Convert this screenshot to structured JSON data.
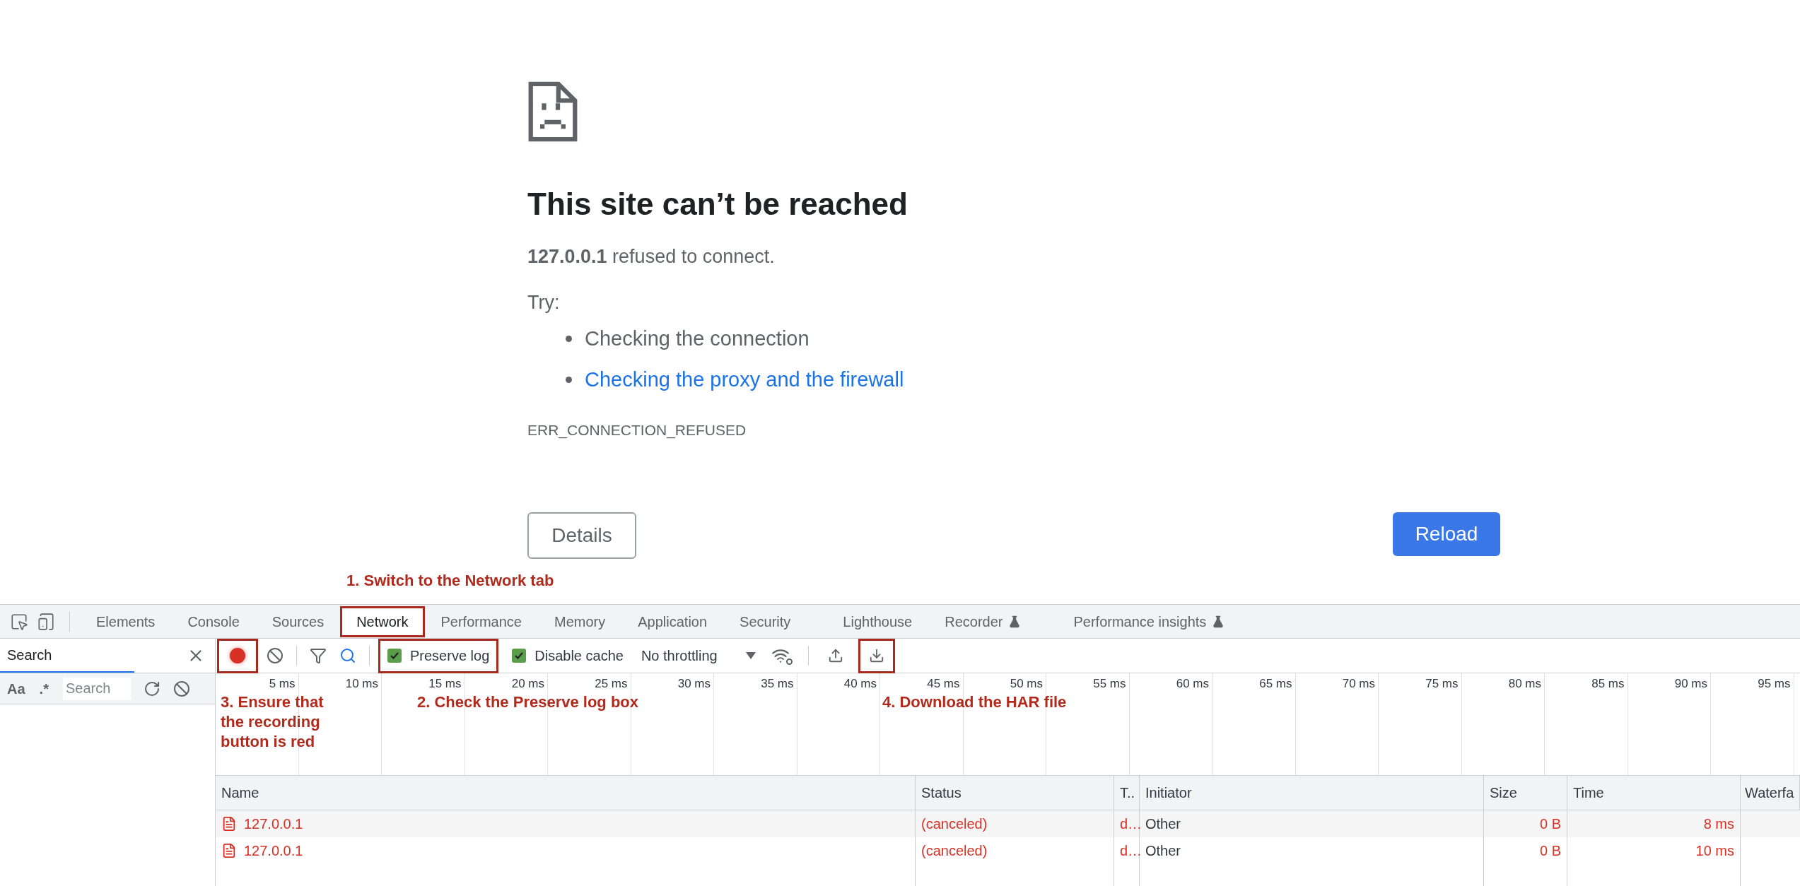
{
  "error_page": {
    "title": "This site can’t be reached",
    "message": "**127.0.0.1** refused to connect.",
    "try_label": "Try:",
    "suggestions": [
      {
        "text": "Checking the connection",
        "kind": "text"
      },
      {
        "text": "Checking the proxy and the firewall",
        "kind": "link"
      }
    ],
    "error_code": "ERR_CONNECTION_REFUSED",
    "details_button": "Details",
    "reload_button": "Reload"
  },
  "annotations": [
    {
      "text": "1. Switch to the Network tab"
    },
    {
      "text": "3. Ensure that the recording button is red"
    },
    {
      "text": "2. Check the Preserve log box"
    },
    {
      "text": "4. Download the HAR file"
    }
  ],
  "devtools": {
    "tabs": [
      {
        "label": "Elements",
        "selected": false,
        "experimental": false,
        "highlighted": false
      },
      {
        "label": "Console",
        "selected": false,
        "experimental": false,
        "highlighted": false
      },
      {
        "label": "Sources",
        "selected": false,
        "experimental": false,
        "highlighted": false
      },
      {
        "label": "Network",
        "selected": true,
        "experimental": false,
        "highlighted": true
      },
      {
        "label": "Performance",
        "selected": false,
        "experimental": false,
        "highlighted": false
      },
      {
        "label": "Memory",
        "selected": false,
        "experimental": false,
        "highlighted": false
      },
      {
        "label": "Application",
        "selected": false,
        "experimental": false,
        "highlighted": false
      },
      {
        "label": "Security",
        "selected": false,
        "experimental": false,
        "highlighted": false
      },
      {
        "label": "Lighthouse",
        "selected": false,
        "experimental": false,
        "highlighted": false
      },
      {
        "label": "Recorder",
        "selected": false,
        "experimental": true,
        "highlighted": false
      },
      {
        "label": "Performance insights",
        "selected": false,
        "experimental": true,
        "highlighted": false
      }
    ],
    "sidebar": {
      "tab": "Search",
      "case_label": "Aa",
      "regex_label": ".*",
      "search_placeholder": "Search"
    },
    "toolbar": {
      "record": {
        "recording": true,
        "highlighted": true
      },
      "preserve_log": {
        "label": "Preserve log",
        "checked": true,
        "highlighted": true
      },
      "disable_cache": {
        "label": "Disable cache",
        "checked": true,
        "highlighted": false
      },
      "throttling": "No throttling",
      "import_har": {
        "highlighted": false
      },
      "export_har": {
        "highlighted": true
      }
    },
    "timeline_ticks": [
      "5 ms",
      "10 ms",
      "15 ms",
      "20 ms",
      "25 ms",
      "30 ms",
      "35 ms",
      "40 ms",
      "45 ms",
      "50 ms",
      "55 ms",
      "60 ms",
      "65 ms",
      "70 ms",
      "75 ms",
      "80 ms",
      "85 ms",
      "90 ms",
      "95 ms"
    ],
    "table": {
      "columns": [
        "Name",
        "Status",
        "T..",
        "Initiator",
        "Size",
        "Time",
        "Waterfa"
      ],
      "rows": [
        {
          "name": "127.0.0.1",
          "status": "(canceled)",
          "type": "d…",
          "initiator": "Other",
          "size": "0 B",
          "time": "8 ms"
        },
        {
          "name": "127.0.0.1",
          "status": "(canceled)",
          "type": "d…",
          "initiator": "Other",
          "size": "0 B",
          "time": "10 ms"
        }
      ]
    }
  }
}
